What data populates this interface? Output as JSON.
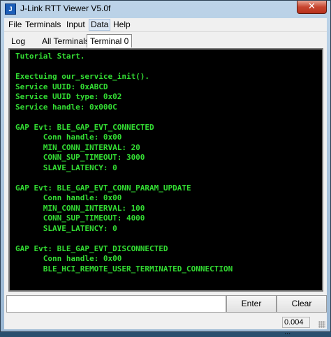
{
  "window": {
    "title": "J-Link RTT Viewer V5.0f",
    "close_glyph": "✕",
    "icon_glyph": "J"
  },
  "menu": {
    "items": [
      "File",
      "Terminals",
      "Input",
      "Data",
      "Help"
    ]
  },
  "tabs": [
    "Log",
    "All Terminals",
    "Terminal 0"
  ],
  "terminal": {
    "lines": [
      "Tutorial Start.",
      "",
      "Exectuing our_service_init().",
      "Service UUID: 0xABCD",
      "Service UUID type: 0x02",
      "Service handle: 0x000C",
      "",
      "GAP Evt: BLE_GAP_EVT_CONNECTED",
      "      Conn handle: 0x00",
      "      MIN_CONN_INTERVAL: 20",
      "      CONN_SUP_TIMEOUT: 3000",
      "      SLAVE_LATENCY: 0",
      "",
      "GAP Evt: BLE_GAP_EVT_CONN_PARAM_UPDATE",
      "      Conn handle: 0x00",
      "      MIN_CONN_INTERVAL: 100",
      "      CONN_SUP_TIMEOUT: 4000",
      "      SLAVE_LATENCY: 0",
      "",
      "GAP Evt: BLE_GAP_EVT_DISCONNECTED",
      "      Conn handle: 0x00",
      "      BLE_HCI_REMOTE_USER_TERMINATED_CONNECTION"
    ],
    "text_color": "#33dd33",
    "background": "#000000"
  },
  "input": {
    "value": "",
    "enter_label": "Enter",
    "clear_label": "Clear"
  },
  "status": {
    "value": "0.004 ..."
  }
}
